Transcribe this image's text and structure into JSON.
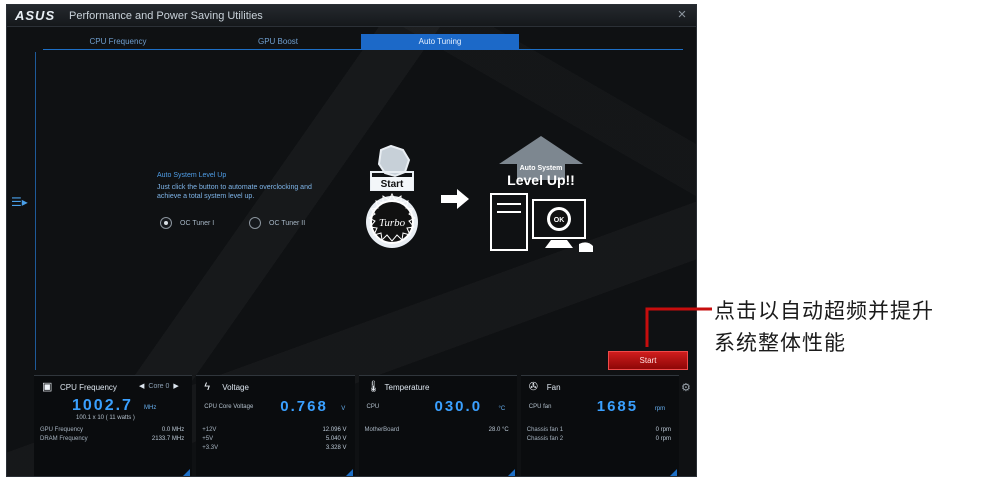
{
  "window": {
    "brand": "ASUS",
    "title": "Performance and Power Saving Utilities",
    "close_icon": "close-icon"
  },
  "tabs": [
    {
      "label": "CPU Frequency",
      "active": false
    },
    {
      "label": "GPU Boost",
      "active": false
    },
    {
      "label": "Auto Tuning",
      "active": true
    }
  ],
  "auto_tuning": {
    "heading": "Auto System Level Up",
    "description": "Just click the button to automate overclocking and achieve a total system level up.",
    "options": [
      {
        "label": "OC Tuner I",
        "selected": true
      },
      {
        "label": "OC Tuner II",
        "selected": false
      }
    ],
    "badge_start": "Start",
    "badge_turbo": "Turbo",
    "levelup_small": "Auto System",
    "levelup_big": "Level Up!!",
    "levelup_ok": "OK",
    "start_button": "Start"
  },
  "panels": {
    "cpu": {
      "title": "CPU Frequency",
      "core_label": "Core 0",
      "value": "1002.7",
      "unit": "MHz",
      "sub": "100.1 x 10 ( 11   watts )",
      "rows": [
        {
          "label": "GPU Frequency",
          "value": "0.0  MHz"
        },
        {
          "label": "DRAM Frequency",
          "value": "2133.7  MHz"
        }
      ]
    },
    "voltage": {
      "title": "Voltage",
      "main_label": "CPU Core Voltage",
      "value": "0.768",
      "unit": "V",
      "rows": [
        {
          "label": "+12V",
          "value": "12.096  V"
        },
        {
          "label": "+5V",
          "value": "5.040  V"
        },
        {
          "label": "+3.3V",
          "value": "3.328  V"
        }
      ]
    },
    "temperature": {
      "title": "Temperature",
      "main_label": "CPU",
      "value": "030.0",
      "unit": "°C",
      "rows": [
        {
          "label": "MotherBoard",
          "value": "28.0 °C"
        }
      ]
    },
    "fan": {
      "title": "Fan",
      "main_label": "CPU fan",
      "value": "1685",
      "unit": "rpm",
      "rows": [
        {
          "label": "Chassis fan 1",
          "value": "0  rpm"
        },
        {
          "label": "Chassis fan 2",
          "value": "0  rpm"
        }
      ]
    }
  },
  "annotation": {
    "line1": "点击以自动超频并提升",
    "line2": "系统整体性能"
  },
  "colors": {
    "accent_blue": "#1c69c8",
    "start_red": "#c01313",
    "value_blue": "#3aa0ff"
  }
}
